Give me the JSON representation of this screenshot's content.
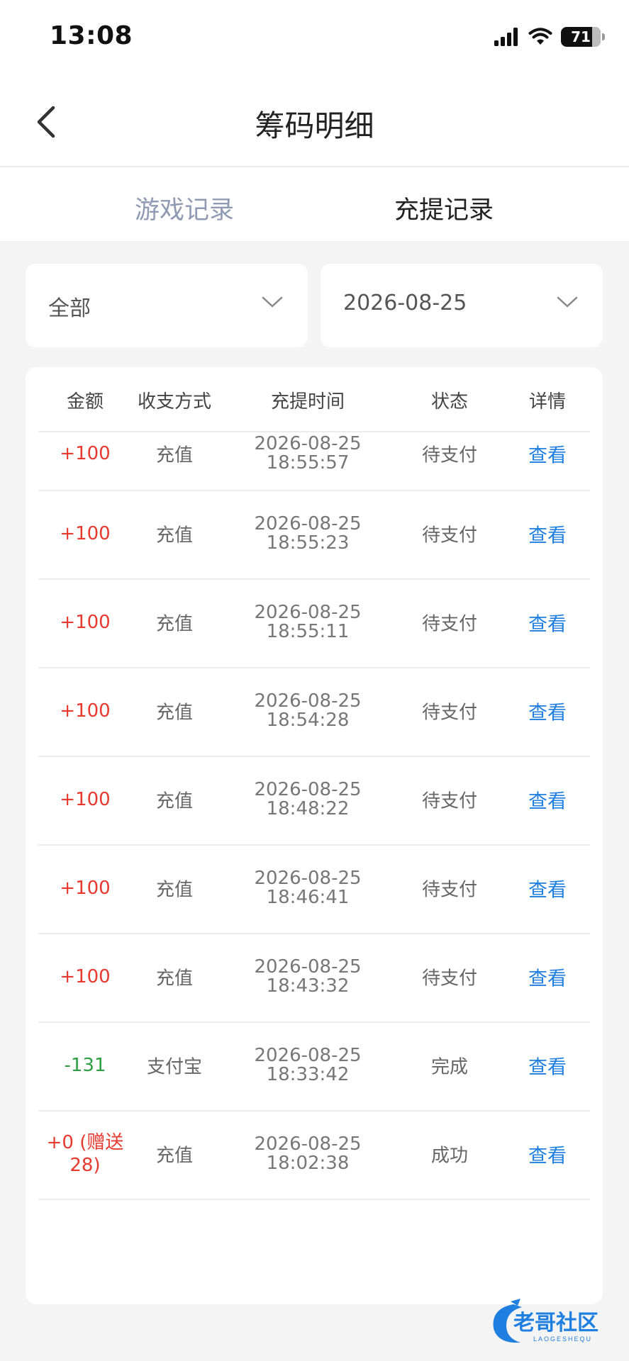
{
  "statusbar": {
    "time": "13:08",
    "battery": "71"
  },
  "header": {
    "title": "筹码明细"
  },
  "tabs": [
    {
      "label": "游戏记录"
    },
    {
      "label": "充提记录"
    }
  ],
  "filters": {
    "type": "全部",
    "date": "2026-08-25"
  },
  "table": {
    "headers": [
      "金额",
      "收支方式",
      "充提时间",
      "状态",
      "详情"
    ],
    "rows": [
      {
        "amount": "+100",
        "method": "充值",
        "date": "2026-08-25",
        "time": "18:55:57",
        "status": "待支付",
        "action": "查看"
      },
      {
        "amount": "+100",
        "method": "充值",
        "date": "2026-08-25",
        "time": "18:55:23",
        "status": "待支付",
        "action": "查看"
      },
      {
        "amount": "+100",
        "method": "充值",
        "date": "2026-08-25",
        "time": "18:55:11",
        "status": "待支付",
        "action": "查看"
      },
      {
        "amount": "+100",
        "method": "充值",
        "date": "2026-08-25",
        "time": "18:54:28",
        "status": "待支付",
        "action": "查看"
      },
      {
        "amount": "+100",
        "method": "充值",
        "date": "2026-08-25",
        "time": "18:48:22",
        "status": "待支付",
        "action": "查看"
      },
      {
        "amount": "+100",
        "method": "充值",
        "date": "2026-08-25",
        "time": "18:46:41",
        "status": "待支付",
        "action": "查看"
      },
      {
        "amount": "+100",
        "method": "充值",
        "date": "2026-08-25",
        "time": "18:43:32",
        "status": "待支付",
        "action": "查看"
      },
      {
        "amount": "-131",
        "method": "支付宝",
        "date": "2026-08-25",
        "time": "18:33:42",
        "status": "完成",
        "action": "查看"
      },
      {
        "amount": "+0 (赠送28)",
        "method": "充值",
        "date": "2026-08-25",
        "time": "18:02:38",
        "status": "成功",
        "action": "查看"
      }
    ]
  },
  "watermark": {
    "text": "老哥社区",
    "subtext": "LAOGESHEQU"
  },
  "colors": {
    "positive": "#e8392f",
    "negative": "#2ea043",
    "link": "#1e7fe0",
    "tab_inactive": "#8f9bb3"
  }
}
